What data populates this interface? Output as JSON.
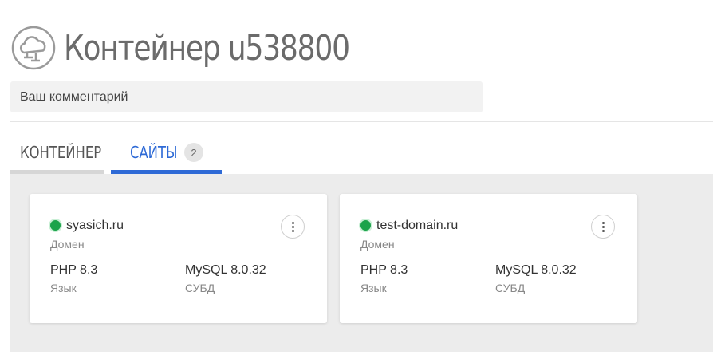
{
  "header": {
    "title": "Контейнер u538800",
    "icon": "cloud-icon"
  },
  "comment": {
    "placeholder": "Ваш комментарий"
  },
  "tabs": [
    {
      "label": "Контейнер",
      "active": false
    },
    {
      "label": "Сайты",
      "active": true,
      "count": "2"
    }
  ],
  "sites": [
    {
      "domain": "syasich.ru",
      "domain_caption": "Домен",
      "status": "active",
      "language": "PHP 8.3",
      "language_caption": "Язык",
      "dbms": "MySQL 8.0.32",
      "dbms_caption": "СУБД"
    },
    {
      "domain": "test-domain.ru",
      "domain_caption": "Домен",
      "status": "active",
      "language": "PHP 8.3",
      "language_caption": "Язык",
      "dbms": "MySQL 8.0.32",
      "dbms_caption": "СУБД"
    }
  ],
  "colors": {
    "accent": "#2e6ad6",
    "status_active": "#1aa34a",
    "panel_bg": "#ececec"
  }
}
